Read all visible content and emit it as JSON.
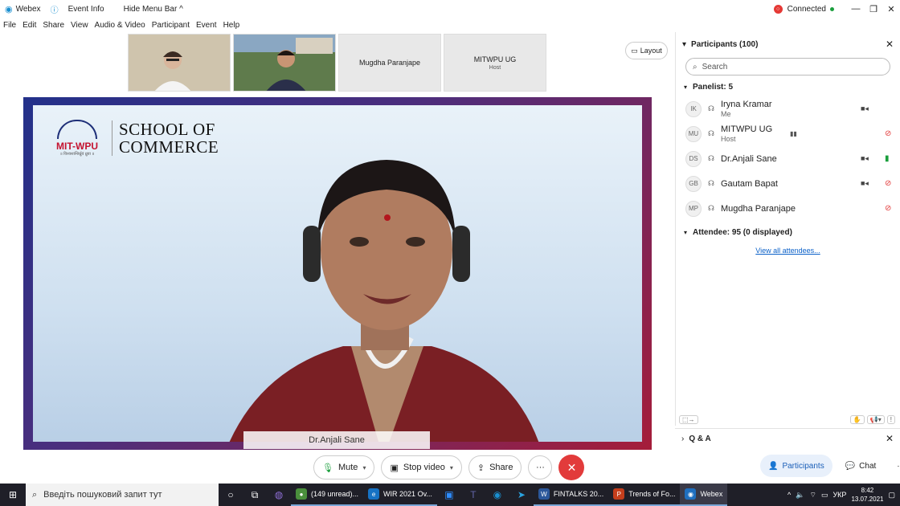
{
  "titlebar": {
    "app_name": "Webex",
    "event_info": "Event Info",
    "hide_menu": "Hide Menu Bar ^",
    "connected": "Connected"
  },
  "menu": [
    "File",
    "Edit",
    "Share",
    "View",
    "Audio & Video",
    "Participant",
    "Event",
    "Help"
  ],
  "thumbnails": [
    {
      "name": "",
      "sub": ""
    },
    {
      "name": "",
      "sub": ""
    },
    {
      "name": "Mugdha Paranjape",
      "sub": ""
    },
    {
      "name": "MITWPU UG",
      "sub": "Host"
    }
  ],
  "layout_label": "Layout",
  "slide": {
    "brand": "MIT-WPU",
    "brand_tag": "॥ विश्वशान्तिर्ध्रुवं ध्रुवा ॥",
    "school_line1": "SCHOOL OF",
    "school_line2": "COMMERCE"
  },
  "speaker_tag": "Dr.Anjali Sane",
  "controls": {
    "mute": "Mute",
    "stop_video": "Stop video",
    "share": "Share",
    "more": "···"
  },
  "participants": {
    "title": "Participants (100)",
    "search_placeholder": "Search",
    "panelist_header": "Panelist: 5",
    "panelists": [
      {
        "initials": "IK",
        "name": "Iryna Kramar",
        "role": "Me"
      },
      {
        "initials": "MU",
        "name": "MITWPU UG",
        "role": "Host"
      },
      {
        "initials": "DS",
        "name": "Dr.Anjali Sane",
        "role": ""
      },
      {
        "initials": "GB",
        "name": "Gautam Bapat",
        "role": ""
      },
      {
        "initials": "MP",
        "name": "Mugdha Paranjape",
        "role": ""
      }
    ],
    "attendee_header": "Attendee: 95 (0 displayed)",
    "view_all": "View all attendees..."
  },
  "qa_label": "Q & A",
  "panel_buttons": {
    "participants": "Participants",
    "chat": "Chat"
  },
  "taskbar": {
    "search_text": "Введіть пошуковий запит тут",
    "apps": [
      {
        "label": "(149 unread)...",
        "color": "#4a8f3c",
        "icon": "chrome-icon"
      },
      {
        "label": "WIR 2021 Ov...",
        "color": "#1672c4",
        "icon": "edge-icon"
      },
      {
        "label": "FINTALKS 20...",
        "color": "#2b579a",
        "icon": "word-icon"
      },
      {
        "label": "Trends of Fo...",
        "color": "#c43e1c",
        "icon": "powerpoint-icon"
      },
      {
        "label": "Webex",
        "color": "#1f6fbf",
        "icon": "webex-icon"
      }
    ],
    "lang": "УКР",
    "time": "8:42",
    "date": "13.07.2021"
  }
}
